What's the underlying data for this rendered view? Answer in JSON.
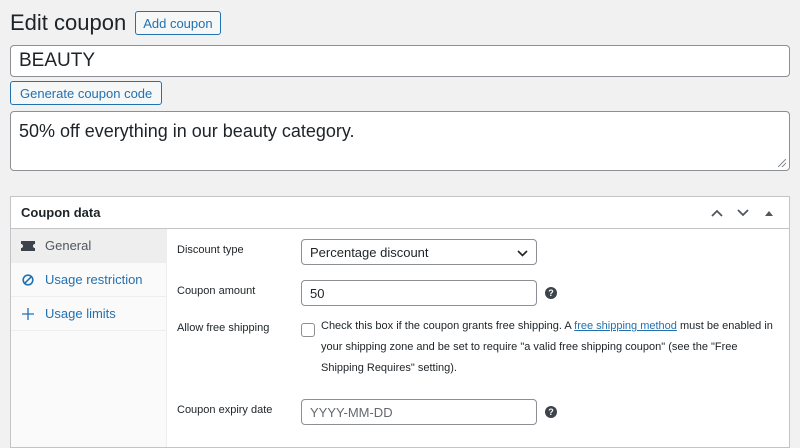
{
  "header": {
    "title": "Edit coupon",
    "add_button": "Add coupon"
  },
  "coupon_code": "BEAUTY",
  "generate_button": "Generate coupon code",
  "description": "50% off everything in our beauty category.",
  "coupon_data": {
    "title": "Coupon data",
    "tabs": [
      {
        "label": "General",
        "icon": "ticket-icon"
      },
      {
        "label": "Usage restriction",
        "icon": "no-entry-icon"
      },
      {
        "label": "Usage limits",
        "icon": "plus-arrows-icon"
      }
    ],
    "fields": {
      "discount_type": {
        "label": "Discount type",
        "value": "Percentage discount"
      },
      "coupon_amount": {
        "label": "Coupon amount",
        "value": "50"
      },
      "free_shipping": {
        "label": "Allow free shipping",
        "text_before": "Check this box if the coupon grants free shipping. A ",
        "link": "free shipping method",
        "text_after": " must be enabled in your shipping zone and be set to require \"a valid free shipping coupon\" (see the \"Free Shipping Requires\" setting)."
      },
      "expiry_date": {
        "label": "Coupon expiry date",
        "placeholder": "YYYY-MM-DD"
      }
    }
  },
  "colors": {
    "accent": "#2271b1",
    "background": "#f1f1f1",
    "border": "#8c8f94"
  }
}
